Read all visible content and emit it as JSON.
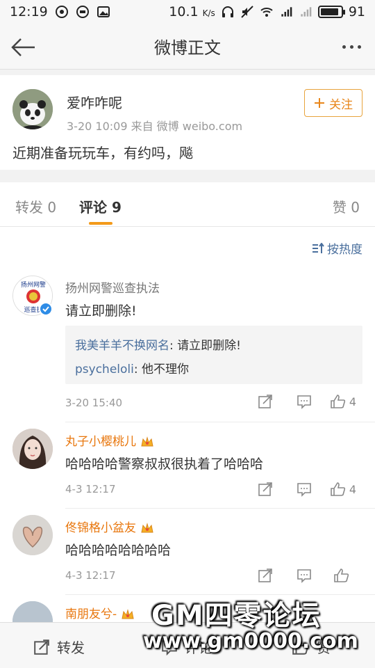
{
  "status_bar": {
    "time": "12:19",
    "net_speed": "10.1",
    "net_unit": "K/s",
    "battery": "91",
    "battery_level": 0.91
  },
  "nav": {
    "title": "微博正文"
  },
  "post": {
    "author": "爱咋咋呢",
    "meta": "3-20 10:09  来自 微博 weibo.com",
    "follow_label": "关注",
    "text": "近期准备玩玩车，有约吗，飚"
  },
  "tabs": {
    "repost": "转发 0",
    "comment": "评论 9",
    "like": "赞 0"
  },
  "sort_label": "按热度",
  "comments": [
    {
      "name": "扬州网警巡查执法",
      "text": "请立即删除!",
      "time": "3-20 15:40",
      "likes": "4",
      "avatar_text_top": "扬州网警",
      "avatar_text_bottom": "巡查执",
      "replies": [
        {
          "name": "我美羊羊不换网名",
          "text": ": 请立即删除!"
        },
        {
          "name": "psycheloli",
          "text": ": 他不理你"
        }
      ]
    },
    {
      "name": "丸子小樱桃儿",
      "text": "哈哈哈哈警察叔叔很执着了哈哈哈",
      "time": "4-3 12:17",
      "likes": "4"
    },
    {
      "name": "佟锦格小盆友",
      "text": "哈哈哈哈哈哈哈哈",
      "time": "4-3 12:17",
      "likes": ""
    },
    {
      "name": "南朋友兮-",
      "text": "",
      "time": "",
      "likes": ""
    }
  ],
  "bottom_bar": {
    "repost": "转发",
    "comment": "评论",
    "like": "赞"
  },
  "watermark": {
    "line1": "GM四零论坛",
    "line2": "www.gm0000.com"
  },
  "colors": {
    "accent_orange": "#e8861b",
    "link_blue": "#4a6f9d"
  }
}
